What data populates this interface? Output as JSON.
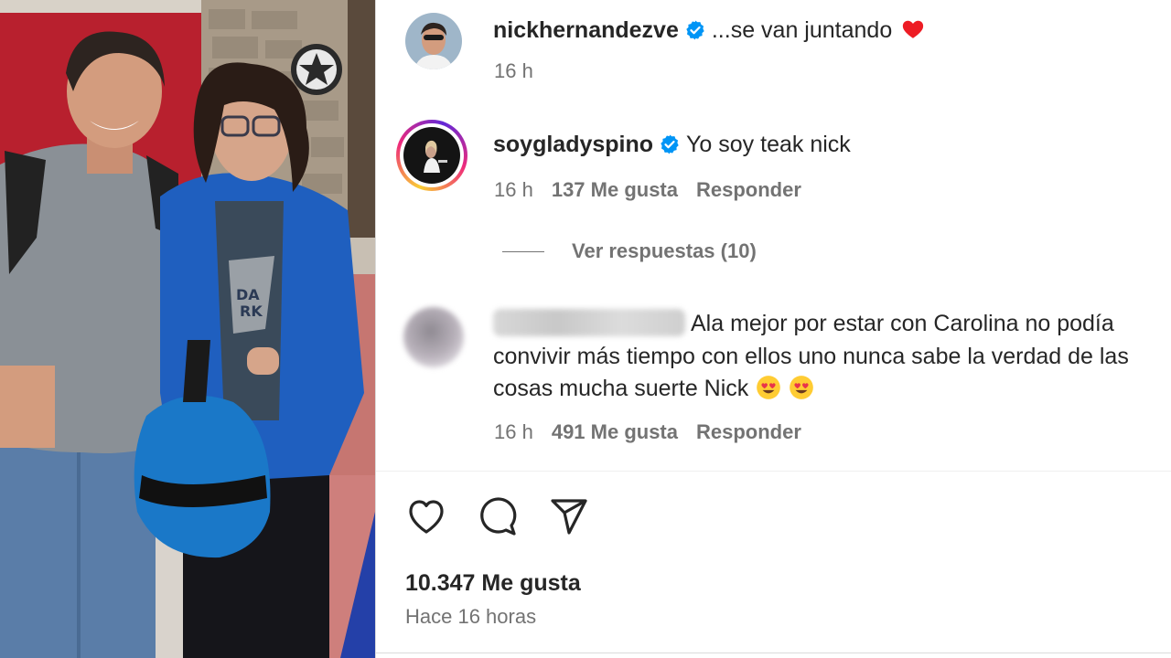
{
  "post": {
    "username": "nickhernandezve",
    "caption": "...se van juntando",
    "caption_emoji": "red-heart",
    "time": "16 h"
  },
  "comments": [
    {
      "username": "soygladyspino",
      "text": "Yo soy teak nick",
      "time": "16 h",
      "likes": "137 Me gusta",
      "reply_label": "Responder",
      "view_replies": "Ver respuestas (10)"
    },
    {
      "username_blurred": true,
      "text_line1": "Ala mejor por estar con Carolina no podía",
      "text_line2": "convivir más tiempo con ellos uno nunca sabe la verdad de las",
      "text_line3": "cosas mucha suerte Nick",
      "emojis": [
        "heart-eyes",
        "heart-eyes"
      ],
      "time": "16 h",
      "likes": "491 Me gusta",
      "reply_label": "Responder"
    }
  ],
  "footer": {
    "likes_total": "10.347 Me gusta",
    "posted": "Hace 16 horas"
  },
  "colors": {
    "verified_blue": "#0095f6",
    "secondary_text": "#737373",
    "primary_text": "#262626",
    "heart_red": "#ed1c24"
  }
}
